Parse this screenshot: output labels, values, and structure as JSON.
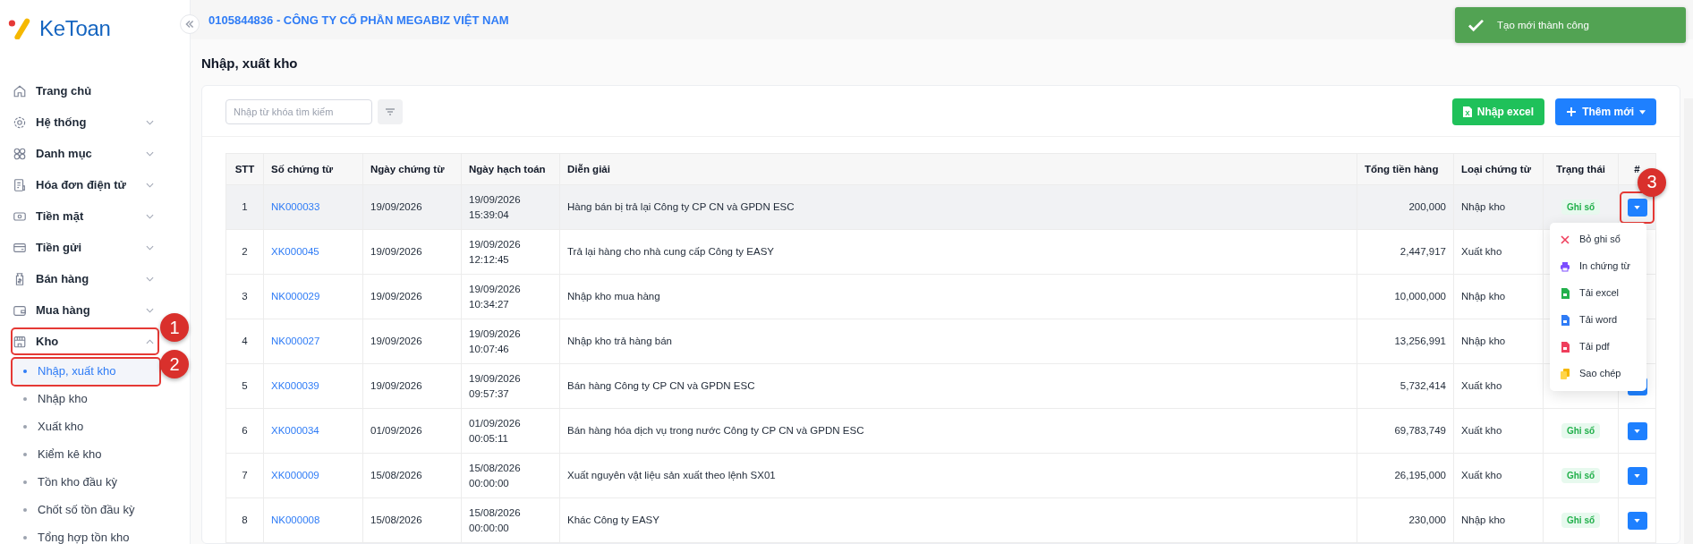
{
  "sidebar": {
    "logo": "KeToan",
    "items": [
      {
        "label": "Trang chủ"
      },
      {
        "label": "Hệ thống",
        "expanded": false
      },
      {
        "label": "Danh mục",
        "expanded": false
      },
      {
        "label": "Hóa đơn điện tử",
        "expanded": false
      },
      {
        "label": "Tiền mặt",
        "expanded": false
      },
      {
        "label": "Tiền gửi",
        "expanded": false
      },
      {
        "label": "Bán hàng",
        "expanded": false
      },
      {
        "label": "Mua hàng",
        "expanded": false
      },
      {
        "label": "Kho",
        "expanded": true,
        "annotation": "1",
        "children": [
          {
            "label": "Nhập, xuất kho",
            "selected": true,
            "annotation": "2"
          },
          {
            "label": "Nhập kho",
            "selected": false
          },
          {
            "label": "Xuất kho",
            "selected": false
          },
          {
            "label": "Kiểm kê kho",
            "selected": false
          },
          {
            "label": "Tồn kho đầu kỳ",
            "selected": false
          },
          {
            "label": "Chốt số tồn đầu kỳ",
            "selected": false
          },
          {
            "label": "Tổng hợp tồn kho",
            "selected": false
          }
        ]
      }
    ]
  },
  "header": {
    "company": "0105844836 - CÔNG TY CỔ PHẦN MEGABIZ VIỆT NAM"
  },
  "toast": {
    "message": "Tạo mới thành công"
  },
  "page_title": "Nhập, xuất kho",
  "toolbar": {
    "search": {
      "placeholder": "Nhập từ khóa tìm kiếm"
    },
    "buttons": [
      {
        "label": "Nhập excel",
        "kind": "excel"
      },
      {
        "label": "Thêm mới",
        "kind": "add"
      }
    ]
  },
  "table": {
    "columns": [
      "STT",
      "Số chứng từ",
      "Ngày chứng từ",
      "Ngày hạch toán",
      "Diễn giải",
      "Tổng tiền hàng",
      "Loại chứng từ",
      "Trạng thái",
      "#"
    ],
    "rows": [
      {
        "stt": "1",
        "number": "NK000033",
        "date": "19/09/2026",
        "posting": [
          "19/09/2026",
          "15:39:04"
        ],
        "description": "Hàng bán bị trả lại Công ty CP CN và GPDN ESC",
        "total": "200,000",
        "type": "Nhập kho",
        "status": "Ghi sổ",
        "button": true,
        "selected": true,
        "annotation": "3"
      },
      {
        "stt": "2",
        "number": "XK000045",
        "date": "19/09/2026",
        "posting": [
          "19/09/2026",
          "12:12:45"
        ],
        "description": "Trả lại hàng cho nhà cung cấp Công ty EASY",
        "total": "2,447,917",
        "type": "Xuất kho",
        "button": false,
        "selected": false
      },
      {
        "stt": "3",
        "number": "NK000029",
        "date": "19/09/2026",
        "posting": [
          "19/09/2026",
          "10:34:27"
        ],
        "description": "Nhập kho mua hàng",
        "total": "10,000,000",
        "type": "Nhập kho",
        "button": false,
        "selected": false
      },
      {
        "stt": "4",
        "number": "NK000027",
        "date": "19/09/2026",
        "posting": [
          "19/09/2026",
          "10:07:46"
        ],
        "description": "Nhập kho trả hàng bán",
        "total": "13,256,991",
        "type": "Nhập kho",
        "button": false,
        "selected": false
      },
      {
        "stt": "5",
        "number": "XK000039",
        "date": "19/09/2026",
        "posting": [
          "19/09/2026",
          "09:57:37"
        ],
        "description": "Bán hàng Công ty CP CN và GPDN ESC",
        "total": "5,732,414",
        "type": "Xuất kho",
        "button": true,
        "selected": false
      },
      {
        "stt": "6",
        "number": "XK000034",
        "date": "01/09/2026",
        "posting": [
          "01/09/2026",
          "00:05:11"
        ],
        "description": "Bán hàng hóa dịch vụ trong nước Công ty CP CN và GPDN ESC",
        "total": "69,783,749",
        "type": "Xuất kho",
        "status": "Ghi sổ",
        "button": true,
        "selected": false
      },
      {
        "stt": "7",
        "number": "XK000009",
        "date": "15/08/2026",
        "posting": [
          "15/08/2026",
          "00:00:00"
        ],
        "description": "Xuất nguyên vật liệu sản xuất theo lệnh SX01",
        "total": "26,195,000",
        "type": "Xuất kho",
        "status": "Ghi sổ",
        "button": true,
        "selected": false
      },
      {
        "stt": "8",
        "number": "NK000008",
        "date": "15/08/2026",
        "posting": [
          "15/08/2026",
          "00:00:00"
        ],
        "description": "Khác Công ty EASY",
        "total": "230,000",
        "type": "Nhập kho",
        "status": "Ghi sổ",
        "button": true,
        "selected": false
      }
    ]
  },
  "row_menu": {
    "items": [
      {
        "label": "Bỏ ghi sổ",
        "kind": "cancel"
      },
      {
        "label": "In chứng từ",
        "kind": "print"
      },
      {
        "label": "Tải excel",
        "kind": "excel"
      },
      {
        "label": "Tải word",
        "kind": "word"
      },
      {
        "label": "Tải pdf",
        "kind": "pdf"
      },
      {
        "label": "Sao chép",
        "kind": "copy"
      }
    ]
  }
}
